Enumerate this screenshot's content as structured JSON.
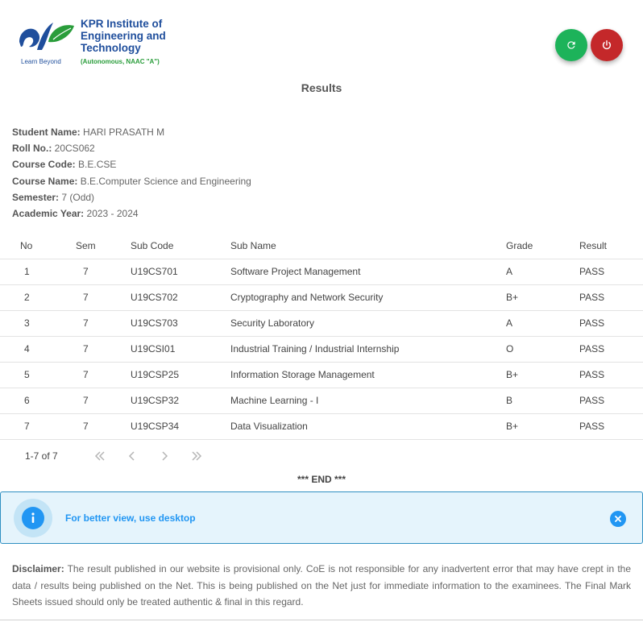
{
  "brand": {
    "name_line1": "KPR Institute of",
    "name_line2": "Engineering and",
    "name_line3": "Technology",
    "tagline": "Learn Beyond",
    "accreditation": "(Autonomous, NAAC \"A\")",
    "primary_color": "#1f4e9c",
    "accent_color": "#2a9d3b"
  },
  "actions": {
    "refresh_icon": "refresh-icon",
    "logout_icon": "power-icon",
    "refresh_color": "#1db35a",
    "logout_color": "#c4282a"
  },
  "page_title": "Results",
  "student": {
    "name_label": "Student Name:",
    "name": "HARI PRASATH M",
    "roll_label": "Roll No.:",
    "roll": "20CS062",
    "course_code_label": "Course Code:",
    "course_code": "B.E.CSE",
    "course_name_label": "Course Name:",
    "course_name": "B.E.Computer Science and Engineering",
    "semester_label": "Semester:",
    "semester": "7 (Odd)",
    "year_label": "Academic Year:",
    "year": "2023 - 2024"
  },
  "table": {
    "headers": [
      "No",
      "Sem",
      "Sub Code",
      "Sub Name",
      "Grade",
      "Result"
    ],
    "rows": [
      [
        "1",
        "7",
        "U19CS701",
        "Software Project Management",
        "A",
        "PASS"
      ],
      [
        "2",
        "7",
        "U19CS702",
        "Cryptography and Network Security",
        "B+",
        "PASS"
      ],
      [
        "3",
        "7",
        "U19CS703",
        "Security Laboratory",
        "A",
        "PASS"
      ],
      [
        "4",
        "7",
        "U19CSI01",
        "Industrial Training / Industrial Internship",
        "O",
        "PASS"
      ],
      [
        "5",
        "7",
        "U19CSP25",
        "Information Storage Management",
        "B+",
        "PASS"
      ],
      [
        "6",
        "7",
        "U19CSP32",
        "Machine Learning - I",
        "B",
        "PASS"
      ],
      [
        "7",
        "7",
        "U19CSP34",
        "Data Visualization",
        "B+",
        "PASS"
      ]
    ]
  },
  "pagination": {
    "range": "1-7 of 7",
    "first_icon": "first-page-icon",
    "prev_icon": "chevron-left-icon",
    "next_icon": "chevron-right-icon",
    "last_icon": "last-page-icon"
  },
  "end_marker": "*** END ***",
  "alert": {
    "message": "For better view, use desktop",
    "icon": "info-icon",
    "close_icon": "close-icon",
    "color": "#2196f3"
  },
  "disclaimer": {
    "label": "Disclaimer:",
    "text": " The result published in our website is provisional only. CoE is not responsible for any inadvertent error that may have crept in the data / results being published on the Net. This is being published on the Net just for immediate information to the examinees. The Final Mark Sheets issued should only be treated authentic & final in this regard."
  }
}
